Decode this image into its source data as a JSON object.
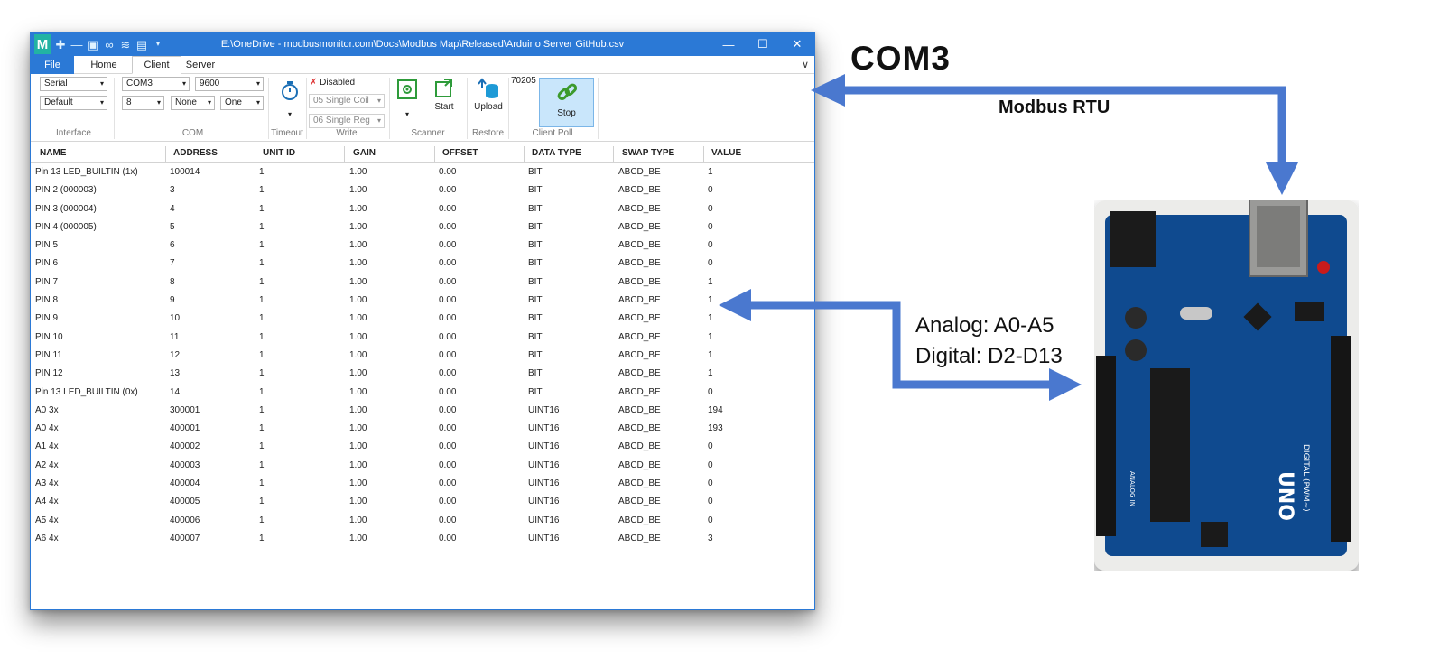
{
  "window": {
    "title": "E:\\OneDrive - modbusmonitor.com\\Docs\\Modbus Map\\Released\\Arduino Server GitHub.csv",
    "logo_letter": "M",
    "controls": {
      "minimize": "—",
      "maximize": "☐",
      "close": "✕"
    }
  },
  "tabs": {
    "file": "File",
    "home": "Home",
    "client": "Client",
    "server": "Server",
    "collapse": "∨"
  },
  "ribbon": {
    "interface": {
      "mode": "Serial",
      "profile": "Default",
      "label": "Interface"
    },
    "com": {
      "port": "COM3",
      "baud": "9600",
      "databits": "8",
      "parity": "None",
      "stopbits": "One",
      "label": "COM"
    },
    "timeout": {
      "label": "Timeout"
    },
    "write": {
      "status": "Disabled",
      "single_coil": "05 Single Coil",
      "single_reg": "06 Single Reg",
      "label": "Write"
    },
    "scanner": {
      "start": "Start",
      "label": "Scanner"
    },
    "restore": {
      "upload": "Upload",
      "label": "Restore"
    },
    "poll": {
      "count": "70205",
      "stop": "Stop",
      "label": "Client Poll"
    }
  },
  "table": {
    "columns": [
      "NAME",
      "ADDRESS",
      "UNIT ID",
      "GAIN",
      "OFFSET",
      "DATA TYPE",
      "SWAP TYPE",
      "VALUE"
    ],
    "rows": [
      [
        "Pin 13 LED_BUILTIN (1x)",
        "100014",
        "1",
        "1.00",
        "0.00",
        "BIT",
        "ABCD_BE",
        "1"
      ],
      [
        "PIN 2 (000003)",
        "3",
        "1",
        "1.00",
        "0.00",
        "BIT",
        "ABCD_BE",
        "0"
      ],
      [
        "PIN 3 (000004)",
        "4",
        "1",
        "1.00",
        "0.00",
        "BIT",
        "ABCD_BE",
        "0"
      ],
      [
        "PIN 4 (000005)",
        "5",
        "1",
        "1.00",
        "0.00",
        "BIT",
        "ABCD_BE",
        "0"
      ],
      [
        "PIN 5",
        "6",
        "1",
        "1.00",
        "0.00",
        "BIT",
        "ABCD_BE",
        "0"
      ],
      [
        "PIN 6",
        "7",
        "1",
        "1.00",
        "0.00",
        "BIT",
        "ABCD_BE",
        "0"
      ],
      [
        "PIN 7",
        "8",
        "1",
        "1.00",
        "0.00",
        "BIT",
        "ABCD_BE",
        "1"
      ],
      [
        "PIN 8",
        "9",
        "1",
        "1.00",
        "0.00",
        "BIT",
        "ABCD_BE",
        "1"
      ],
      [
        "PIN 9",
        "10",
        "1",
        "1.00",
        "0.00",
        "BIT",
        "ABCD_BE",
        "1"
      ],
      [
        "PIN 10",
        "11",
        "1",
        "1.00",
        "0.00",
        "BIT",
        "ABCD_BE",
        "1"
      ],
      [
        "PIN 11",
        "12",
        "1",
        "1.00",
        "0.00",
        "BIT",
        "ABCD_BE",
        "1"
      ],
      [
        "PIN 12",
        "13",
        "1",
        "1.00",
        "0.00",
        "BIT",
        "ABCD_BE",
        "1"
      ],
      [
        "Pin 13 LED_BUILTIN (0x)",
        "14",
        "1",
        "1.00",
        "0.00",
        "BIT",
        "ABCD_BE",
        "0"
      ],
      [
        "A0 3x",
        "300001",
        "1",
        "1.00",
        "0.00",
        "UINT16",
        "ABCD_BE",
        "194"
      ],
      [
        "A0 4x",
        "400001",
        "1",
        "1.00",
        "0.00",
        "UINT16",
        "ABCD_BE",
        "193"
      ],
      [
        "A1 4x",
        "400002",
        "1",
        "1.00",
        "0.00",
        "UINT16",
        "ABCD_BE",
        "0"
      ],
      [
        "A2 4x",
        "400003",
        "1",
        "1.00",
        "0.00",
        "UINT16",
        "ABCD_BE",
        "0"
      ],
      [
        "A3 4x",
        "400004",
        "1",
        "1.00",
        "0.00",
        "UINT16",
        "ABCD_BE",
        "0"
      ],
      [
        "A4 4x",
        "400005",
        "1",
        "1.00",
        "0.00",
        "UINT16",
        "ABCD_BE",
        "0"
      ],
      [
        "A5 4x",
        "400006",
        "1",
        "1.00",
        "0.00",
        "UINT16",
        "ABCD_BE",
        "0"
      ],
      [
        "A6 4x",
        "400007",
        "1",
        "1.00",
        "0.00",
        "UINT16",
        "ABCD_BE",
        "3"
      ]
    ]
  },
  "annotations": {
    "com3": "COM3",
    "protocol": "Modbus RTU",
    "analog": "Analog: A0-A5",
    "digital": "Digital: D2-D13",
    "arrow_color": "#4a78cf"
  },
  "board": {
    "label": "UNO",
    "subtitle": "DIGITAL (PWM~)",
    "analog_label": "ANALOG IN"
  }
}
